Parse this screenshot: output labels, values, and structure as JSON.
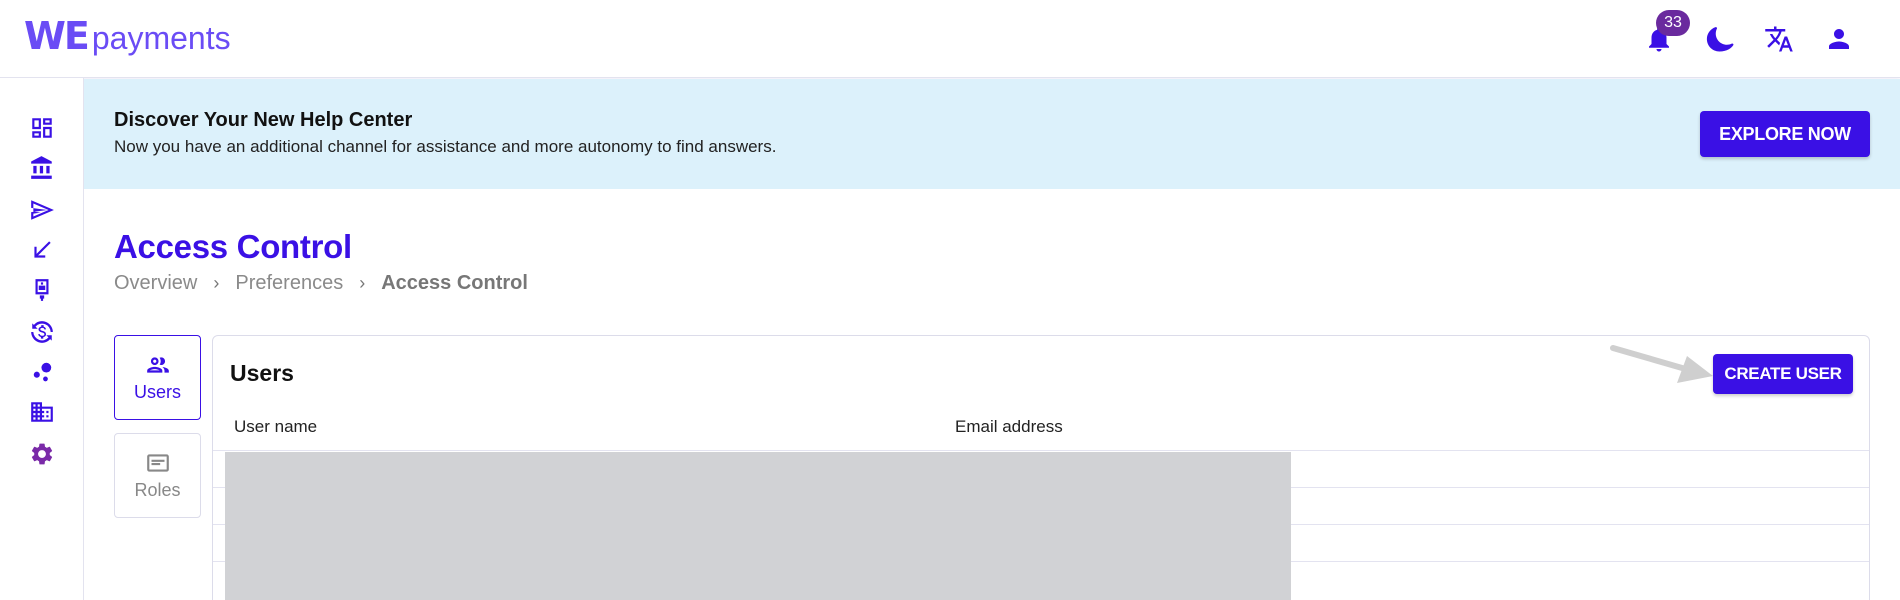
{
  "header": {
    "logo_we": "WE",
    "logo_payments": "payments",
    "notification_count": "33",
    "icons": [
      "bell-icon",
      "moon-icon",
      "translate-icon",
      "user-icon"
    ]
  },
  "sidebar": {
    "items": [
      {
        "icon": "dashboard-icon"
      },
      {
        "icon": "bank-icon"
      },
      {
        "icon": "send-icon"
      },
      {
        "icon": "receive-arrow-icon"
      },
      {
        "icon": "pos-terminal-icon"
      },
      {
        "icon": "exchange-icon"
      },
      {
        "icon": "bubbles-icon"
      },
      {
        "icon": "company-icon"
      },
      {
        "icon": "settings-icon"
      }
    ]
  },
  "banner": {
    "title": "Discover Your New Help Center",
    "text": "Now you have an additional channel for assistance and more autonomy to find answers.",
    "button_label": "EXPLORE NOW"
  },
  "page": {
    "title": "Access Control",
    "breadcrumb": [
      "Overview",
      "Preferences",
      "Access Control"
    ]
  },
  "tabs": {
    "users_label": "Users",
    "roles_label": "Roles"
  },
  "users_panel": {
    "title": "Users",
    "create_button": "CREATE USER",
    "columns": [
      "User name",
      "Email address"
    ]
  },
  "colors": {
    "brand": "#3a10e5",
    "logo": "#6a4cf5",
    "banner_bg": "#dcf1fb",
    "badge": "#6a2a9e"
  }
}
